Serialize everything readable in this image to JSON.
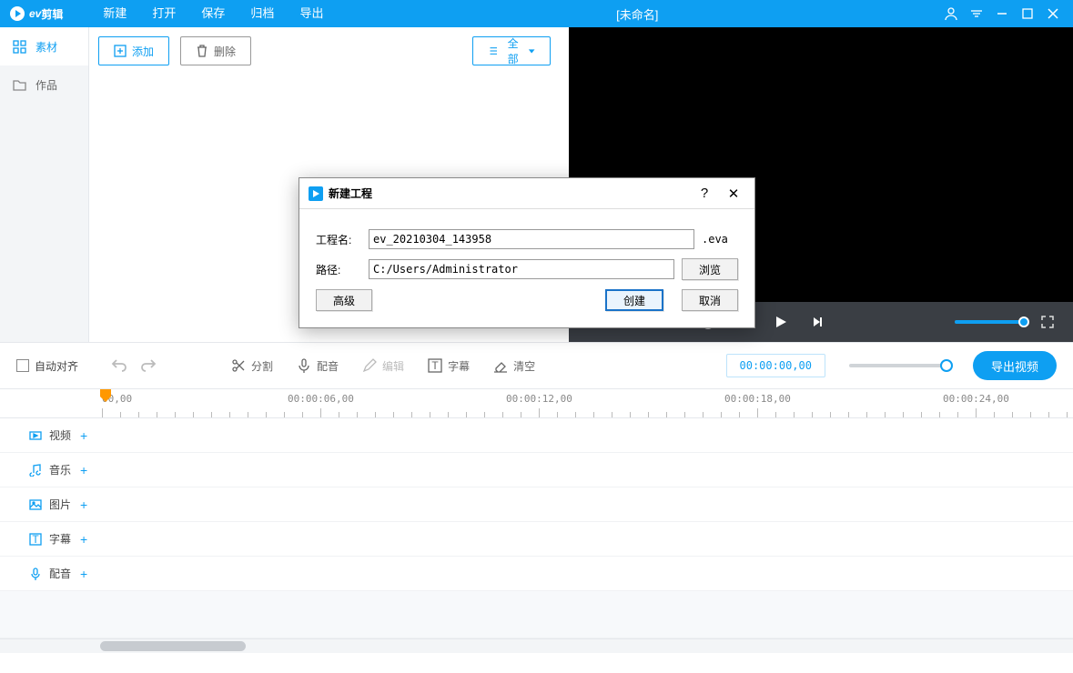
{
  "app": {
    "name": "剪辑",
    "title": "[未命名]"
  },
  "menu": {
    "new": "新建",
    "open": "打开",
    "save": "保存",
    "archive": "归档",
    "export": "导出"
  },
  "sidebar": {
    "material": "素材",
    "works": "作品"
  },
  "toolbar": {
    "add": "添加",
    "delete": "删除",
    "all": "全部"
  },
  "mid": {
    "autoalign": "自动对齐",
    "split": "分割",
    "dub": "配音",
    "edit": "编辑",
    "subtitle": "字幕",
    "clear": "清空",
    "timecode": "00:00:00,00",
    "export": "导出视频"
  },
  "ruler": {
    "t0": "00,00",
    "t1": "00:00:06,00",
    "t2": "00:00:12,00",
    "t3": "00:00:18,00",
    "t4": "00:00:24,00"
  },
  "tracks": {
    "video": "视频",
    "music": "音乐",
    "image": "图片",
    "subtitle": "字幕",
    "dub": "配音",
    "plus": "+"
  },
  "dialog": {
    "title": "新建工程",
    "lbl_name": "工程名:",
    "name_value": "ev_20210304_143958",
    "ext": ".eva",
    "lbl_path": "路径:",
    "path_value": "C:/Users/Administrator",
    "browse": "浏览",
    "advanced": "高级",
    "create": "创建",
    "cancel": "取消",
    "help": "?",
    "close": "✕"
  }
}
